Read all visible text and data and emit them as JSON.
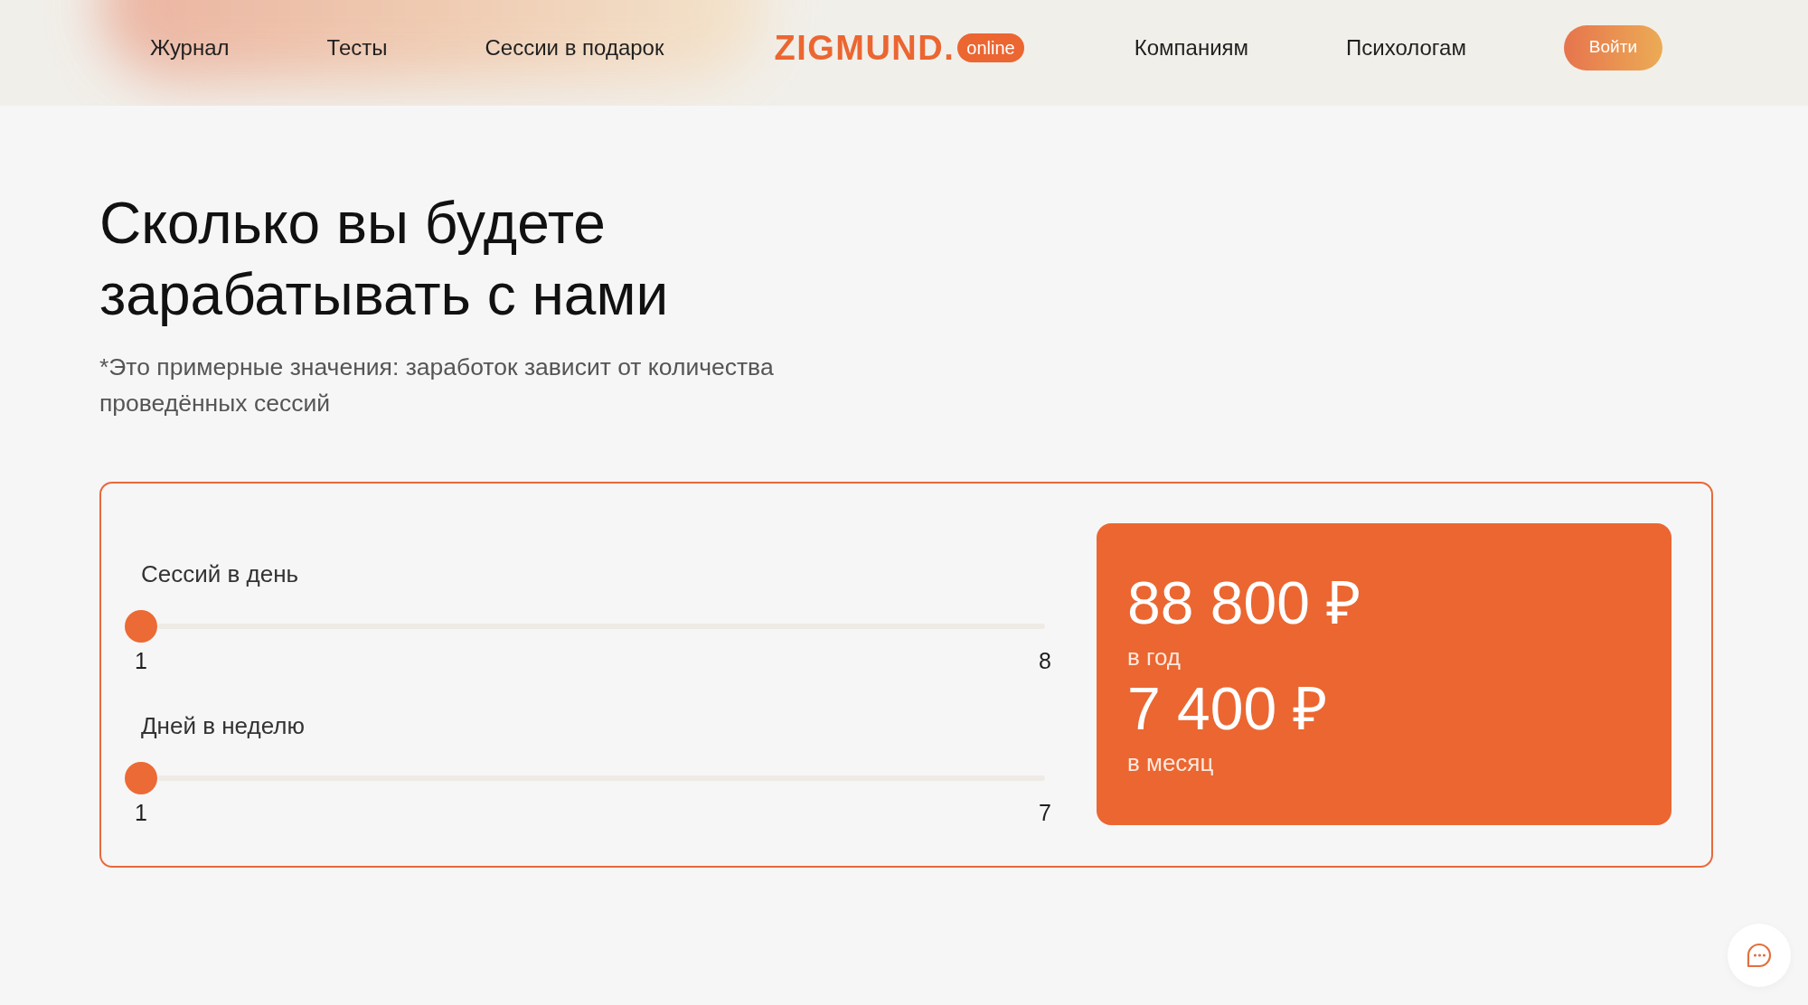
{
  "header": {
    "nav_left": [
      {
        "label": "Журнал"
      },
      {
        "label": "Тесты"
      },
      {
        "label": "Сессии в подарок"
      }
    ],
    "logo": {
      "wordmark": "ZIGMUND.",
      "badge": "online"
    },
    "nav_right": [
      {
        "label": "Компаниям"
      },
      {
        "label": "Психологам"
      }
    ],
    "login_button": "Войти"
  },
  "calculator": {
    "title": "Сколько вы будете зарабатывать с нами",
    "note": "*Это примерные значения: заработок зависит от количества проведённых сессий",
    "sliders": [
      {
        "label": "Сессий в день",
        "level": 0,
        "min_label": "1",
        "max_label": "8"
      },
      {
        "label": "Дней в неделю",
        "level": 0,
        "min_label": "1",
        "max_label": "7"
      }
    ],
    "results": [
      {
        "amount": "88 800 ₽",
        "period": "в год"
      },
      {
        "amount": "7 400 ₽",
        "period": "в месяц"
      }
    ]
  }
}
